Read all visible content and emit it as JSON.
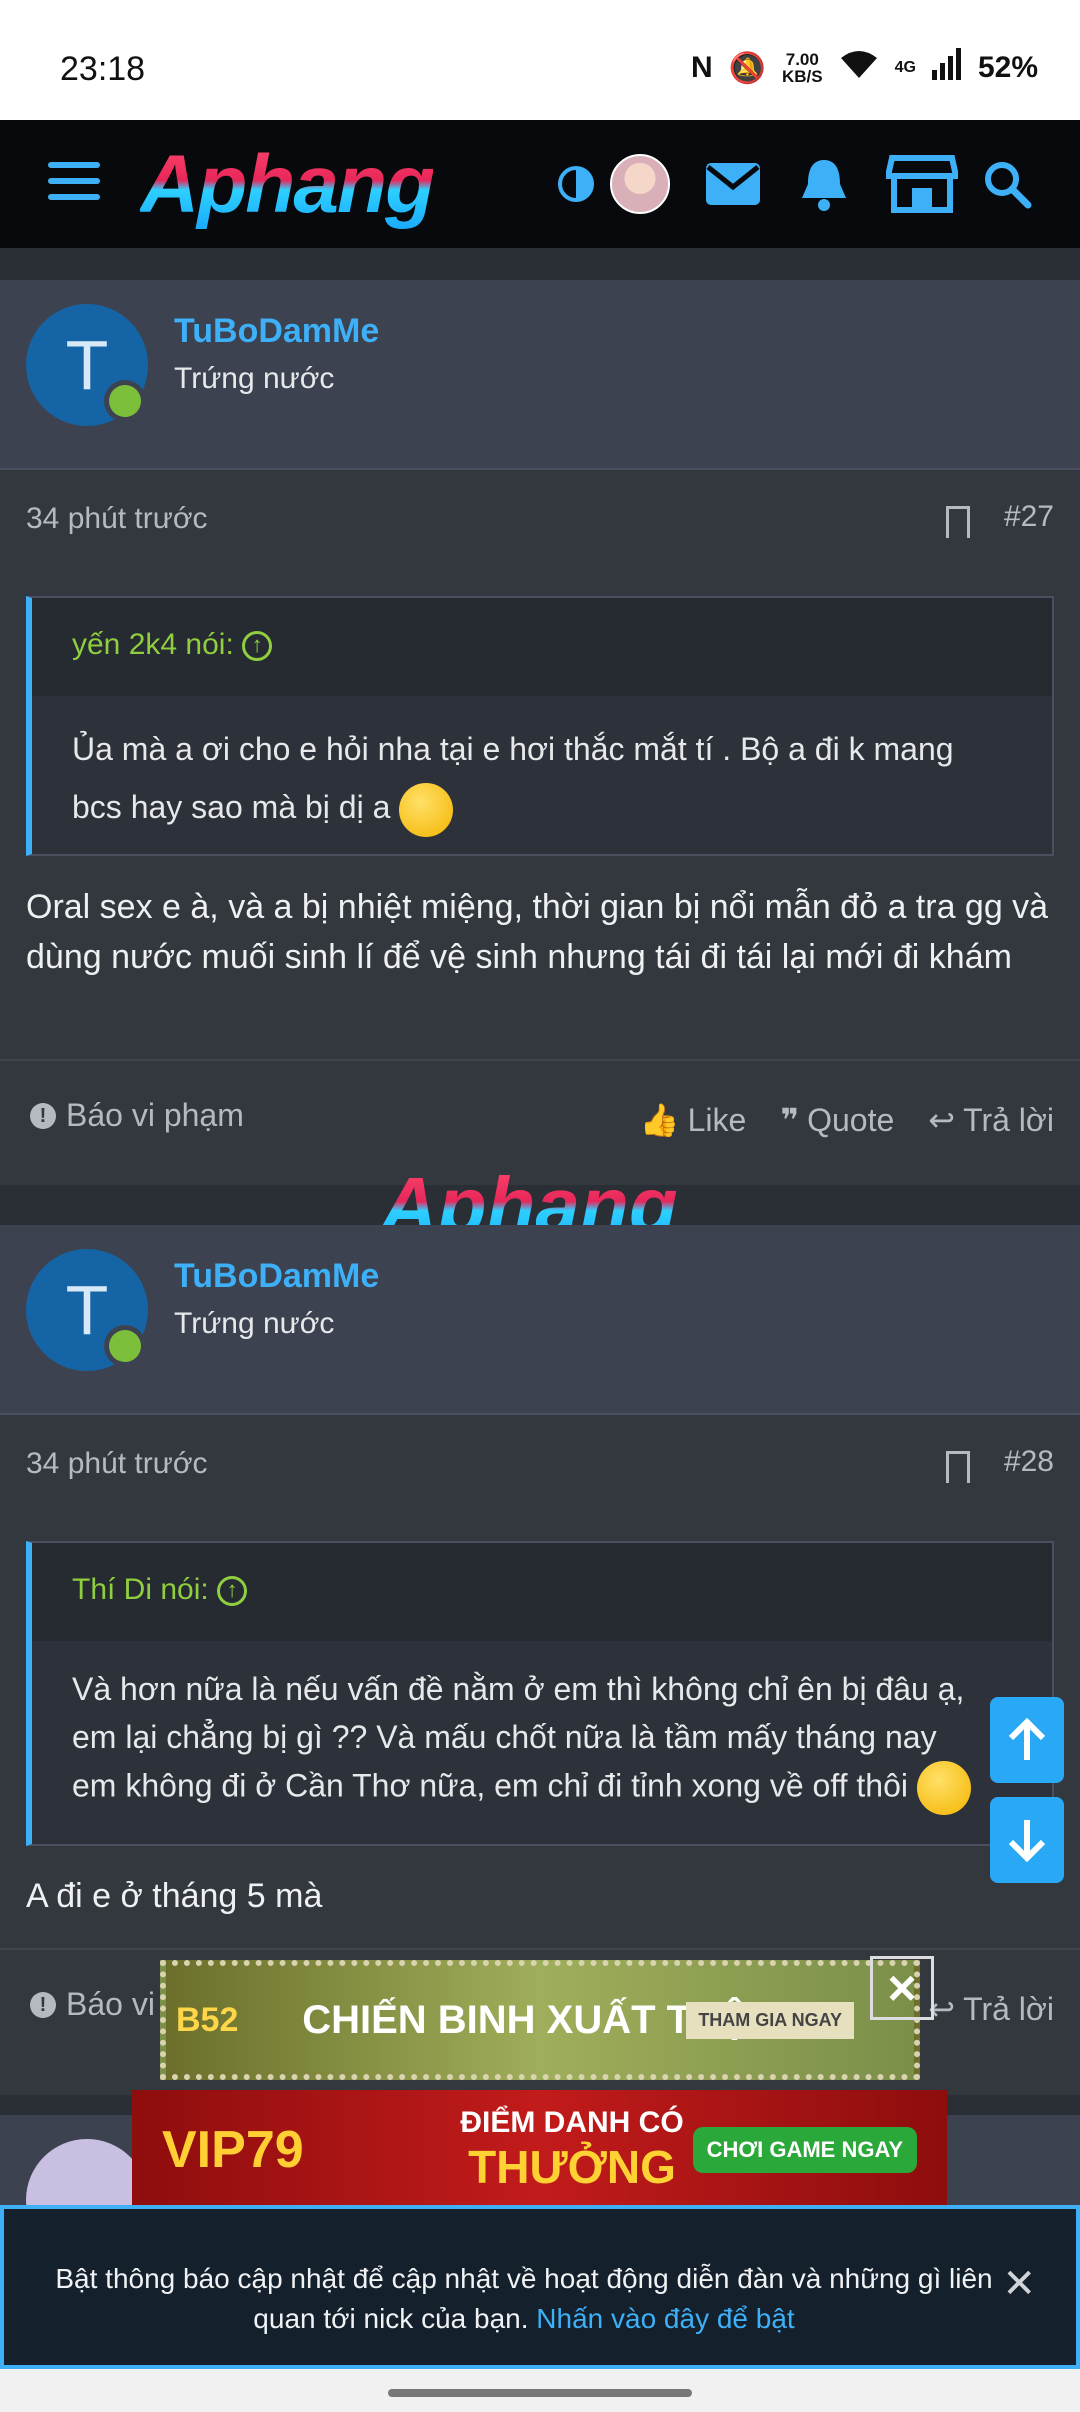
{
  "status": {
    "time": "23:18",
    "speed_value": "7.00",
    "speed_unit": "KB/S",
    "network": "4G",
    "battery": "52%"
  },
  "header": {
    "logo": "Aphang"
  },
  "posts": [
    {
      "username": "TuBoDamMe",
      "user_title": "Trứng nước",
      "avatar_letter": "T",
      "time": "34 phút trước",
      "number": "#27",
      "quote_author": "yến 2k4 nói:",
      "quote_text": "Ủa mà a ơi cho e hỏi nha tại e hơi thắc mắt tí . Bộ a đi k mang bcs hay sao mà bị dị a",
      "body": "Oral sex e à, và a bị nhiệt miệng, thời gian bị nổi mẫn đỏ a tra gg và dùng nước muối sinh lí để vệ sinh nhưng tái đi tái lại mới đi khám",
      "report": "Báo vi phạm",
      "like": "Like",
      "quote": "Quote",
      "reply": "Trả lời"
    },
    {
      "username": "TuBoDamMe",
      "user_title": "Trứng nước",
      "avatar_letter": "T",
      "time": "34 phút trước",
      "number": "#28",
      "quote_author": "Thí Di nói:",
      "quote_text": "Và hơn nữa là nếu vấn đề nằm ở em thì không chỉ ên bị đâu ạ, em lại chẳng bị gì ?? Và mấu chốt nữa là tầm mấy tháng nay em không đi ở Cần Thơ nữa, em chỉ đi tỉnh xong về off thôi",
      "body": "A đi e ở tháng 5 mà",
      "report": "Báo vi",
      "reply": "Trả lời"
    }
  ],
  "watermark": "Aphang",
  "ads": {
    "ad1_brand": "B52",
    "ad1_text": "CHIẾN BINH XUẤT TRẬN",
    "ad1_cta": "THAM GIA NGAY",
    "ad2_brand": "VIP79",
    "ad2_line1": "ĐIỂM DANH CÓ",
    "ad2_line2": "THƯỞNG",
    "ad2_cta": "CHƠI GAME NGAY"
  },
  "notification": {
    "text": "Bật thông báo cập nhật để cập nhật về hoạt động diễn đàn và những gì liên quan tới nick của bạn.",
    "link": "Nhấn vào đây để bật"
  }
}
